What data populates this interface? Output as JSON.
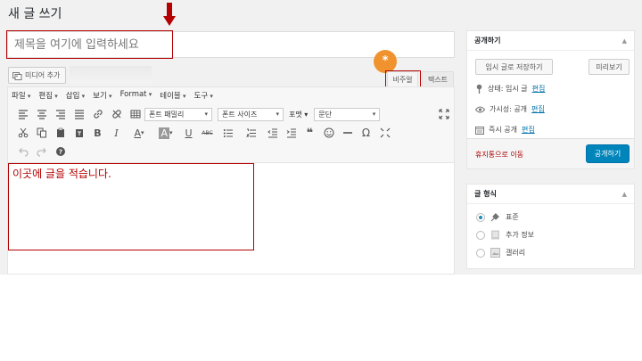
{
  "page_title": "새 글 쓰기",
  "title_field": {
    "placeholder": "제목을 여기에 입력하세요"
  },
  "media_button": {
    "label": "미디어 추가"
  },
  "annotations": {
    "marker": "*",
    "content_note": "이곳에 글을 적습니다."
  },
  "editor_tabs": {
    "visual": "비주얼",
    "text": "텍스트"
  },
  "menubar": [
    "파일",
    "편집",
    "삽입",
    "보기",
    "Format",
    "테이블",
    "도구"
  ],
  "toolbar": {
    "font_family": "폰트 패밀리",
    "font_size": "폰트 사이즈",
    "format_label": "포맷",
    "paragraph": "문단",
    "bold": "B",
    "italic": "I",
    "underline": "U",
    "strike": "ABC",
    "text_color": "A",
    "highlight": "A",
    "quote": "❝",
    "omega": "Ω"
  },
  "publish_box": {
    "title": "공개하기",
    "save_draft": "임시 글로 저장하기",
    "preview": "미리보기",
    "status_label": "상태: 임시 글",
    "visibility_label": "가시성: 공개",
    "schedule_label": "즉시 공개",
    "edit_link": "편집",
    "trash": "휴지통으로 이동",
    "publish": "공개하기"
  },
  "format_box": {
    "title": "글 형식",
    "options": [
      "표준",
      "추가 정보",
      "갤러리"
    ],
    "selected": "표준"
  },
  "colors": {
    "accent": "#0085ba",
    "annotation": "#b40000",
    "marker": "#f0932f"
  }
}
